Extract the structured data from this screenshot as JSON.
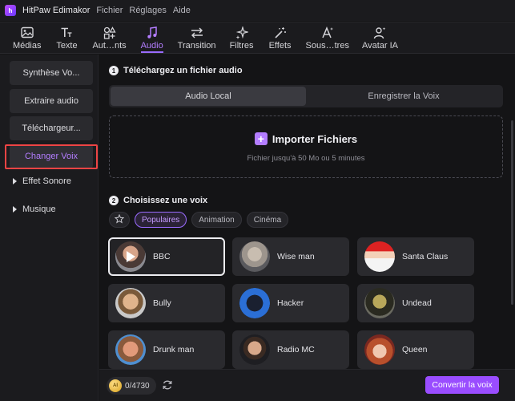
{
  "app": {
    "name": "HitPaw Edimakor",
    "logo_text": "h"
  },
  "menu": [
    "Fichier",
    "Réglages",
    "Aide"
  ],
  "toolbar": [
    {
      "label": "Médias",
      "icon": "image-icon"
    },
    {
      "label": "Texte",
      "icon": "text-icon"
    },
    {
      "label": "Aut…nts",
      "icon": "shapes-icon"
    },
    {
      "label": "Audio",
      "icon": "music-note-icon",
      "active": true
    },
    {
      "label": "Transition",
      "icon": "transition-arrows-icon"
    },
    {
      "label": "Filtres",
      "icon": "sparkles-icon"
    },
    {
      "label": "Effets",
      "icon": "magic-wand-icon"
    },
    {
      "label": "Sous…tres",
      "icon": "subtitle-icon"
    },
    {
      "label": "Avatar IA",
      "icon": "avatar-icon"
    }
  ],
  "sidebar": {
    "buttons": [
      "Synthèse Vo...",
      "Extraire audio",
      "Téléchargeur...",
      "Changer Voix"
    ],
    "groups": [
      "Effet Sonore",
      "Musique"
    ]
  },
  "upload": {
    "step": "1",
    "title": "Téléchargez un fichier audio",
    "tabs": [
      "Audio Local",
      "Enregistrer la Voix"
    ],
    "import_label": "Importer Fichiers",
    "import_sub": "Fichier jusqu'à 50 Mo ou 5 minutes"
  },
  "voices": {
    "step": "2",
    "title": "Choisissez une voix",
    "filters": [
      "Populaires",
      "Animation",
      "Cinéma"
    ],
    "items": [
      {
        "name": "BBC",
        "selected": true
      },
      {
        "name": "Wise man"
      },
      {
        "name": "Santa Claus"
      },
      {
        "name": "Bully"
      },
      {
        "name": "Hacker"
      },
      {
        "name": "Undead"
      },
      {
        "name": "Drunk man"
      },
      {
        "name": "Radio MC"
      },
      {
        "name": "Queen"
      }
    ]
  },
  "footer": {
    "coin_text": "AI",
    "credits": "0/4730",
    "convert_label": "Convertir la voix"
  },
  "colors": {
    "accent": "#9a6bff",
    "highlight": "#e44444"
  }
}
